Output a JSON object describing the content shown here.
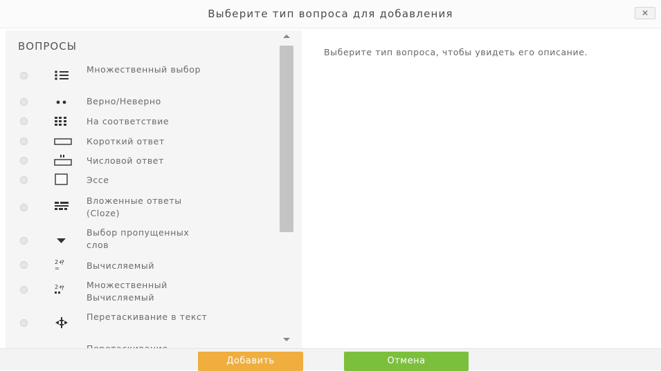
{
  "dialog": {
    "title": "Выберите тип вопроса для добавления",
    "close_label": "✕"
  },
  "questions": {
    "section_title": "ВОПРОСЫ",
    "items": [
      {
        "label": "Множественный выбор",
        "icon": "multichoice-icon"
      },
      {
        "label": "Верно/Неверно",
        "icon": "truefalse-icon"
      },
      {
        "label": "На соответствие",
        "icon": "match-icon"
      },
      {
        "label": "Короткий ответ",
        "icon": "shortanswer-icon"
      },
      {
        "label": "Числовой ответ",
        "icon": "numerical-icon"
      },
      {
        "label": "Эссе",
        "icon": "essay-icon"
      },
      {
        "label": "Вложенные ответы (Cloze)",
        "icon": "cloze-icon"
      },
      {
        "label": "Выбор пропущенных слов",
        "icon": "gapselect-icon"
      },
      {
        "label": "Вычисляемый",
        "icon": "calculated-icon"
      },
      {
        "label": "Множественный Вычисляемый",
        "icon": "calculatedmulti-icon"
      },
      {
        "label": "Перетаскивание в текст",
        "icon": "ddwtos-icon"
      },
      {
        "label": "Перетаскивание",
        "icon": "ddimage-icon"
      }
    ]
  },
  "description": {
    "text": "Выберите тип вопроса, чтобы увидеть его описание."
  },
  "footer": {
    "add_label": "Добавить",
    "cancel_label": "Отмена"
  },
  "colors": {
    "add_button": "#f0ae3f",
    "cancel_button": "#7cbf3d",
    "panel_bg": "#f5f5f5",
    "scroll_thumb": "#c4c4c4"
  }
}
